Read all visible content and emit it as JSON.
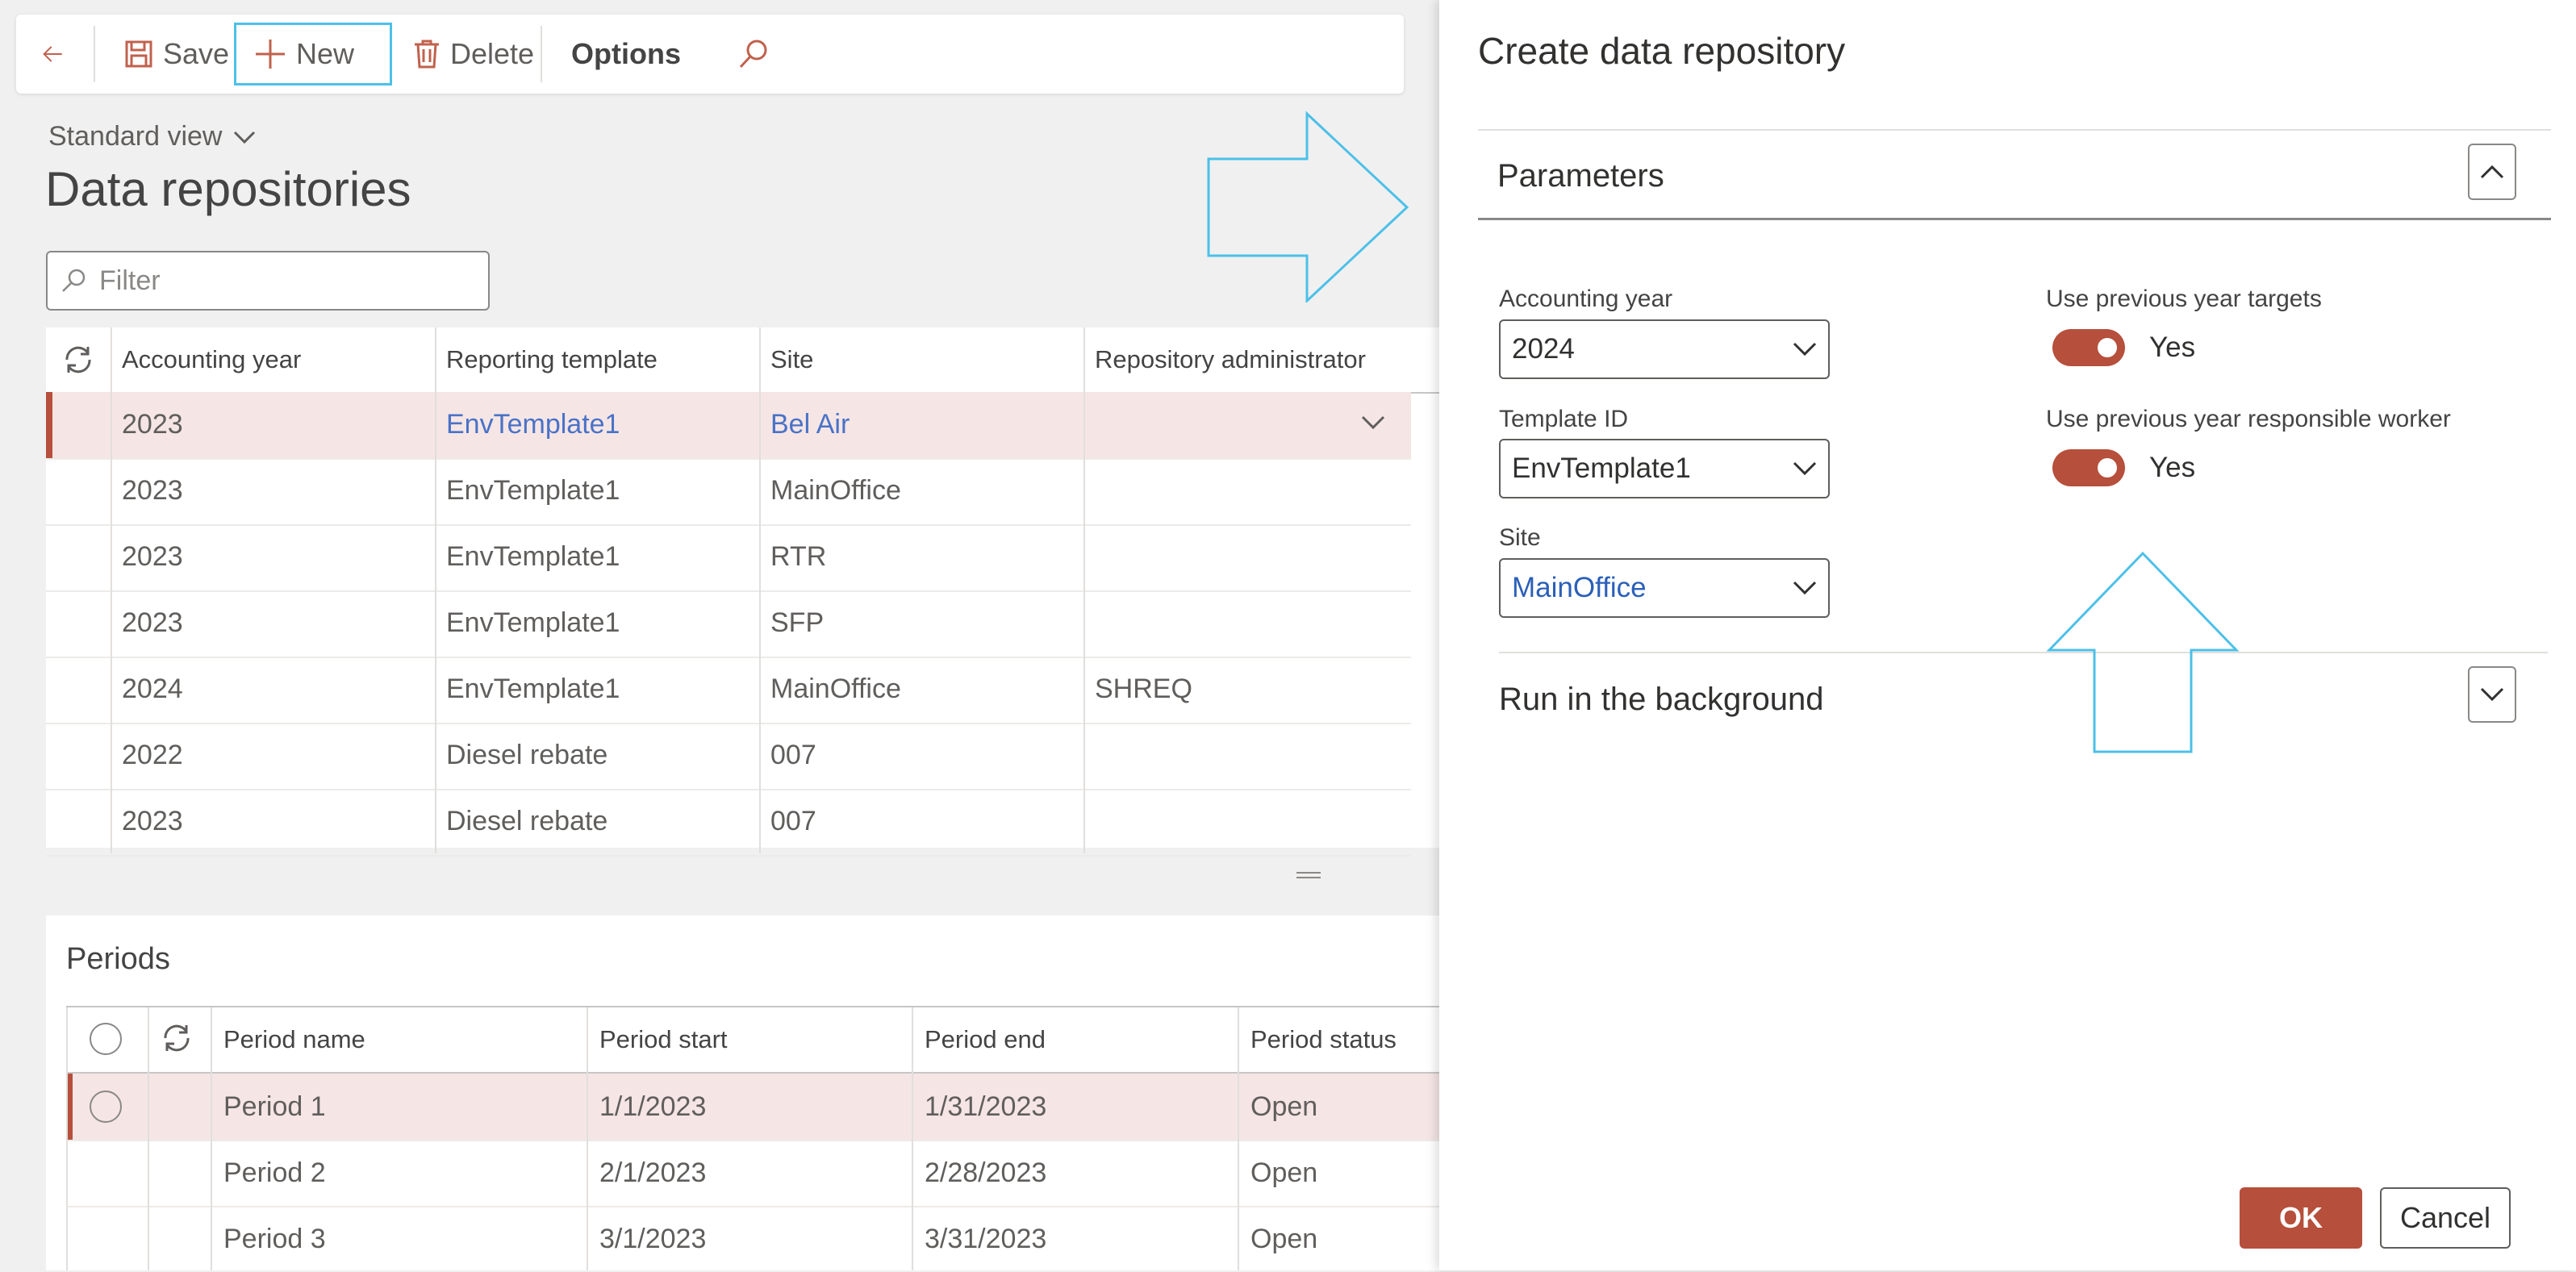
{
  "toolbar": {
    "save_label": "Save",
    "new_label": "New",
    "delete_label": "Delete",
    "options_label": "Options"
  },
  "page": {
    "view_label": "Standard view",
    "title": "Data repositories",
    "filter_placeholder": "Filter"
  },
  "grid": {
    "columns": [
      "Accounting year",
      "Reporting template",
      "Site",
      "Repository administrator"
    ],
    "rows": [
      {
        "year": "2023",
        "template": "EnvTemplate1",
        "site": "Bel Air",
        "admin": ""
      },
      {
        "year": "2023",
        "template": "EnvTemplate1",
        "site": "MainOffice",
        "admin": ""
      },
      {
        "year": "2023",
        "template": "EnvTemplate1",
        "site": "RTR",
        "admin": ""
      },
      {
        "year": "2023",
        "template": "EnvTemplate1",
        "site": "SFP",
        "admin": ""
      },
      {
        "year": "2024",
        "template": "EnvTemplate1",
        "site": "MainOffice",
        "admin": "SHREQ"
      },
      {
        "year": "2022",
        "template": "Diesel rebate",
        "site": "007",
        "admin": ""
      },
      {
        "year": "2023",
        "template": "Diesel rebate",
        "site": "007",
        "admin": ""
      }
    ]
  },
  "periods": {
    "title": "Periods",
    "columns": [
      "Period name",
      "Period start",
      "Period end",
      "Period status"
    ],
    "rows": [
      {
        "name": "Period 1",
        "start": "1/1/2023",
        "end": "1/31/2023",
        "status": "Open"
      },
      {
        "name": "Period 2",
        "start": "2/1/2023",
        "end": "2/28/2023",
        "status": "Open"
      },
      {
        "name": "Period 3",
        "start": "3/1/2023",
        "end": "3/31/2023",
        "status": "Open"
      }
    ]
  },
  "dialog": {
    "title": "Create data repository",
    "parameters_title": "Parameters",
    "accounting_year_label": "Accounting year",
    "accounting_year_value": "2024",
    "template_id_label": "Template ID",
    "template_id_value": "EnvTemplate1",
    "site_label": "Site",
    "site_value": "MainOffice",
    "prev_targets_label": "Use previous year targets",
    "prev_targets_value": "Yes",
    "prev_worker_label": "Use previous year responsible worker",
    "prev_worker_value": "Yes",
    "background_title": "Run in the background",
    "ok_label": "OK",
    "cancel_label": "Cancel"
  },
  "colors": {
    "accent": "#b64f3b",
    "link": "#4a72c7",
    "callout": "#4cc0e8"
  }
}
